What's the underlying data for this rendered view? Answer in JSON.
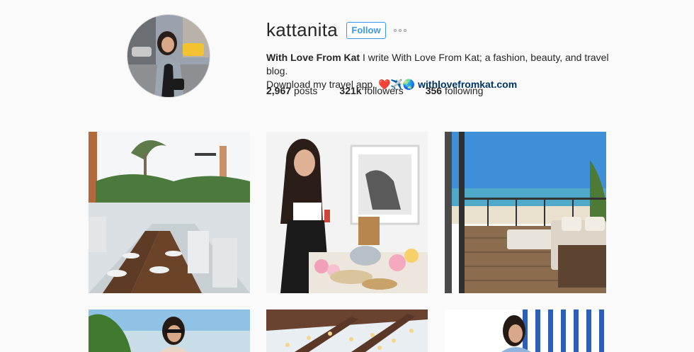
{
  "profile": {
    "username": "kattanita",
    "follow_label": "Follow",
    "more_label": "Options",
    "bio": {
      "name": "With Love From Kat",
      "line1": " I write With Love From Kat; a fashion, beauty, and travel blog.",
      "line2": "Download my travel app. ",
      "emoji": "❤️✈️🌏",
      "link": "withlovefromkat.com"
    },
    "stats": {
      "posts_count": "2,967",
      "posts_label": "posts",
      "followers_count": "321k",
      "followers_label": "followers",
      "following_count": "356",
      "following_label": "following"
    }
  },
  "posts": [
    {
      "name": "post-restaurant-terrace"
    },
    {
      "name": "post-woman-with-wine-and-cheese"
    },
    {
      "name": "post-ocean-view-balcony"
    },
    {
      "name": "post-woman-by-sea"
    },
    {
      "name": "post-pergola-string-lights"
    },
    {
      "name": "post-woman-blue-stripes"
    }
  ],
  "colors": {
    "accent": "#3897f0",
    "link": "#003569",
    "background": "#fafafa"
  }
}
